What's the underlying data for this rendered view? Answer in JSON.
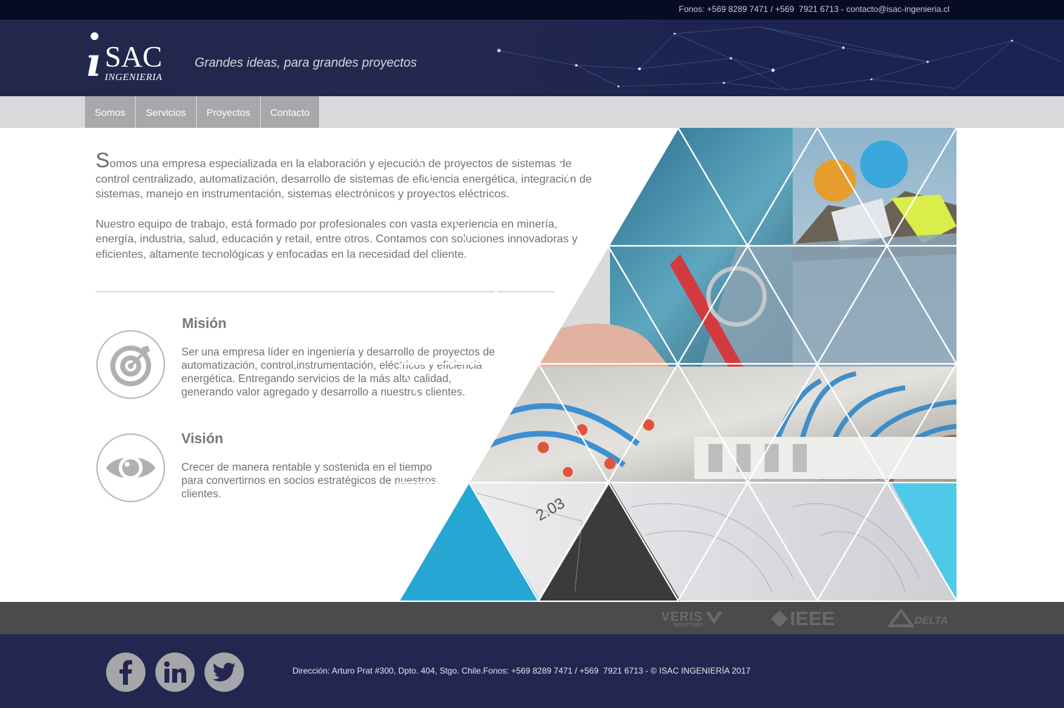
{
  "topbar": {
    "contact_text": "Fonos: +569 8289 7471 / +569  7921 6713 - contacto@isac-ingenieria.cl"
  },
  "header": {
    "logo_text": "SAC",
    "logo_subtext": "INGENIERIA",
    "tagline": "Grandes ideas, para grandes proyectos"
  },
  "nav": {
    "items": [
      {
        "label": "Somos"
      },
      {
        "label": "Servicios"
      },
      {
        "label": "Proyectos"
      },
      {
        "label": "Contacto"
      }
    ]
  },
  "intro": {
    "first_letter": "S",
    "paragraph1_rest": "omos una empresa especializada en la elaboración y ejecución de proyectos de sistemas de control centralizado, automatización, desarrollo de sistemas de eficiencia energética, integración de sistemas, manejo en instrumentación, sistemas electrónicos y proyectos eléctricos.",
    "paragraph2": "Nuestro equipo de trabajo, está formado por profesionales con vasta experiencia en minería, energía, industria, salud, educación y retail, entre otros. Contamos con soluciones innovadoras y eficientes, altamente tecnológicas y enfocadas en la necesidad del cliente."
  },
  "mission": {
    "title": "Misión",
    "text": "Ser una empresa líder en ingeniería y desarrollo de proyectos de automatización, control,instrumentación, eléctricos y eficiencia energética. Entregando servicios de la más alta calidad, generando valor agregado y desarrollo a nuestros clientes."
  },
  "vision": {
    "title": "Visión",
    "text": "Crecer de manera rentable y sostenida en el tiempo para convertirnos en socios estratégicos de nuestros clientes."
  },
  "partners": {
    "veris": "VERIS",
    "veris_sub": "INDUSTRIES",
    "ieee": "IEEE",
    "delta": "DELTA"
  },
  "footer": {
    "address": "Dirección: Arturo Prat #300, Dpto. 404, Stgo. Chile.Fonos: +569 8289 7471 / +569  7921 6713 - © ISAC INGENIERÍA 2017",
    "social": [
      "facebook-icon",
      "linkedin-icon",
      "twitter-icon"
    ]
  }
}
